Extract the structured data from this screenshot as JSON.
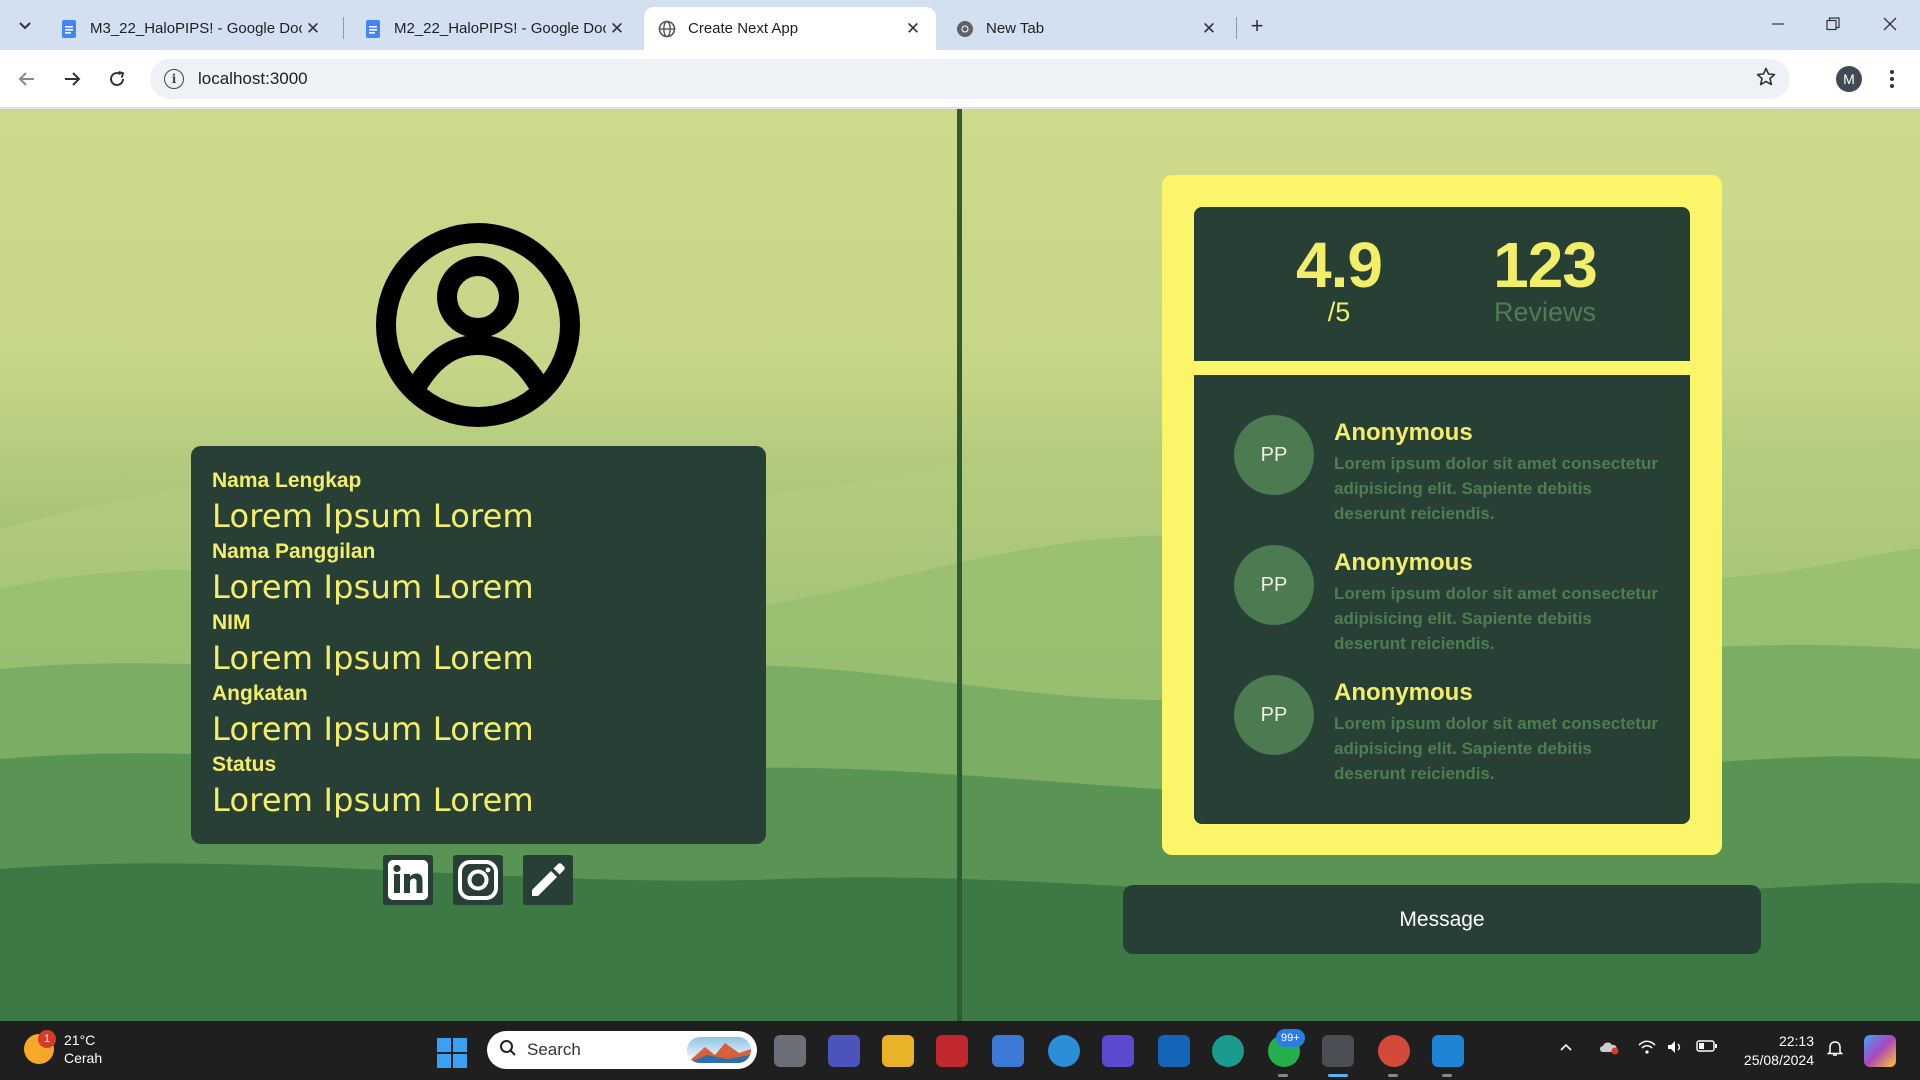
{
  "browser": {
    "tabs": [
      {
        "title": "M3_22_HaloPIPS! - Google Doc",
        "favicon": "google-docs-icon",
        "active": false
      },
      {
        "title": "M2_22_HaloPIPS! - Google Doc",
        "favicon": "google-docs-icon",
        "active": false
      },
      {
        "title": "Create Next App",
        "favicon": "globe-icon",
        "active": true
      },
      {
        "title": "New Tab",
        "favicon": "chrome-icon",
        "active": false
      }
    ],
    "close_glyph": "✕",
    "new_tab_glyph": "+",
    "url": "localhost:3000",
    "profile_initial": "M"
  },
  "profile": {
    "fields": [
      {
        "label": "Nama Lengkap",
        "value": "Lorem Ipsum Lorem"
      },
      {
        "label": "Nama Panggilan",
        "value": "Lorem Ipsum Lorem"
      },
      {
        "label": "NIM",
        "value": "Lorem Ipsum Lorem"
      },
      {
        "label": "Angkatan",
        "value": "Lorem Ipsum Lorem"
      },
      {
        "label": "Status",
        "value": "Lorem Ipsum Lorem"
      }
    ],
    "social_icons": [
      "linkedin-icon",
      "instagram-icon",
      "edit-icon"
    ]
  },
  "ratings": {
    "score": "4.9",
    "score_suffix": "/5",
    "review_count": "123",
    "review_label": "Reviews"
  },
  "reviews": [
    {
      "initials": "PP",
      "name": "Anonymous",
      "text": "Lorem ipsum dolor sit amet consectetur adipisicing elit. Sapiente debitis deserunt reiciendis."
    },
    {
      "initials": "PP",
      "name": "Anonymous",
      "text": "Lorem ipsum dolor sit amet consectetur adipisicing elit. Sapiente debitis deserunt reiciendis."
    },
    {
      "initials": "PP",
      "name": "Anonymous",
      "text": "Lorem ipsum dolor sit amet consectetur adipisicing elit. Sapiente debitis deserunt reiciendis."
    }
  ],
  "message_button": "Message",
  "colors": {
    "panel_dark": "#283f35",
    "accent_yellow": "#f3ee6a",
    "panel_yellow": "#fbf56a",
    "muted_green": "#4f7d50"
  },
  "taskbar": {
    "weather_temp": "21°C",
    "weather_desc": "Cerah",
    "weather_badge": "1",
    "search_placeholder": "Search",
    "whatsapp_badge": "99+",
    "time": "22:13",
    "date": "25/08/2024"
  }
}
